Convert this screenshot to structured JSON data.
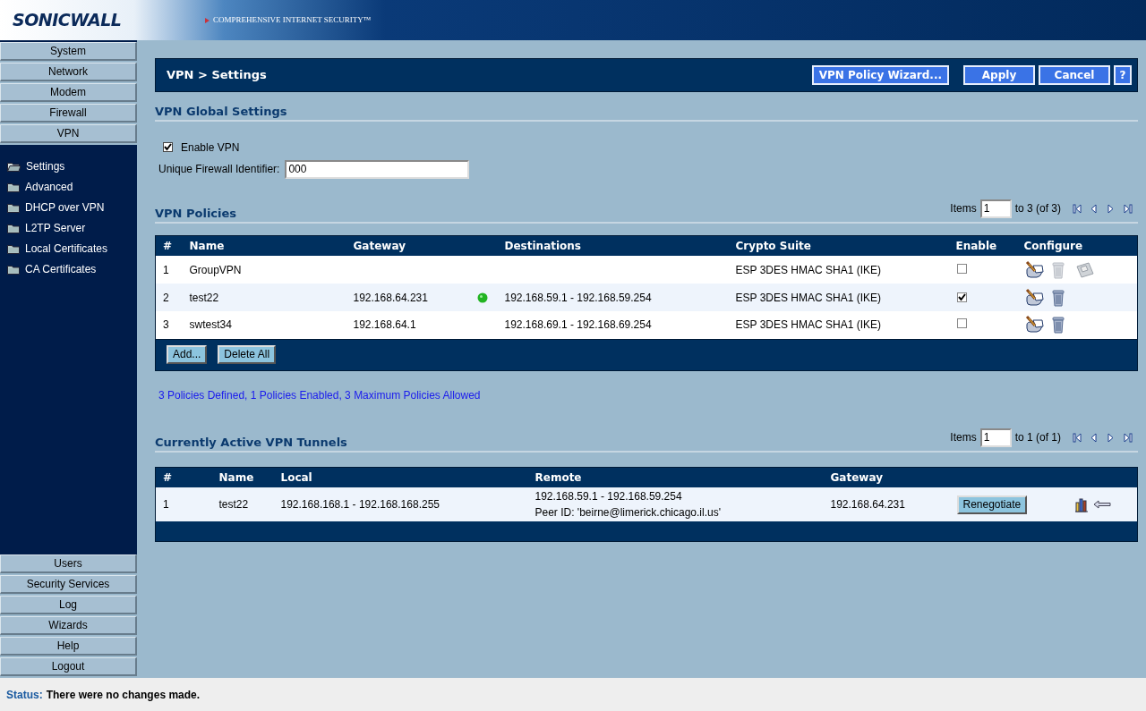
{
  "header": {
    "logo": "SONICWALL",
    "tagline": "COMPREHENSIVE INTERNET SECURITY™"
  },
  "nav_top": [
    {
      "label": "System"
    },
    {
      "label": "Network"
    },
    {
      "label": "Modem"
    },
    {
      "label": "Firewall"
    },
    {
      "label": "VPN"
    }
  ],
  "nav_items": [
    {
      "label": "Settings",
      "selected": true
    },
    {
      "label": "Advanced",
      "selected": false
    },
    {
      "label": "DHCP over VPN",
      "selected": false
    },
    {
      "label": "L2TP Server",
      "selected": false
    },
    {
      "label": "Local Certificates",
      "selected": false
    },
    {
      "label": "CA Certificates",
      "selected": false
    }
  ],
  "nav_bottom": [
    {
      "label": "Users"
    },
    {
      "label": "Security Services"
    },
    {
      "label": "Log"
    },
    {
      "label": "Wizards"
    },
    {
      "label": "Help"
    },
    {
      "label": "Logout"
    }
  ],
  "title_bar": {
    "title": "VPN > Settings",
    "buttons": [
      "VPN Policy Wizard...",
      "Apply",
      "Cancel",
      "?"
    ]
  },
  "global_settings": {
    "heading": "VPN Global Settings",
    "enable_label": "Enable VPN",
    "enable_checked": true,
    "identifier_label": "Unique Firewall Identifier:",
    "identifier_value": "000"
  },
  "policies": {
    "heading": "VPN Policies",
    "pager": {
      "label": "Items",
      "value": "1",
      "range": "to 3 (of 3)"
    },
    "columns": [
      "#",
      "Name",
      "Gateway",
      "Destinations",
      "Crypto Suite",
      "Enable",
      "Configure"
    ],
    "rows": [
      {
        "num": "1",
        "name": "GroupVPN",
        "gateway": "",
        "tunnel_up": false,
        "destinations": "",
        "crypto": "ESP 3DES HMAC SHA1 (IKE)",
        "enabled": false,
        "delete_disabled": true,
        "has_export": true
      },
      {
        "num": "2",
        "name": "test22",
        "gateway": "192.168.64.231",
        "tunnel_up": true,
        "destinations": "192.168.59.1 - 192.168.59.254",
        "crypto": "ESP 3DES HMAC SHA1 (IKE)",
        "enabled": true,
        "delete_disabled": false,
        "has_export": false
      },
      {
        "num": "3",
        "name": "swtest34",
        "gateway": "192.168.64.1",
        "tunnel_up": false,
        "destinations": "192.168.69.1 - 192.168.69.254",
        "crypto": "ESP 3DES HMAC SHA1 (IKE)",
        "enabled": false,
        "delete_disabled": false,
        "has_export": false
      }
    ],
    "buttons": [
      "Add...",
      "Delete All"
    ],
    "summary": "3 Policies Defined, 1 Policies Enabled, 3 Maximum Policies Allowed"
  },
  "tunnels": {
    "heading": "Currently Active VPN Tunnels",
    "pager": {
      "label": "Items",
      "value": "1",
      "range": "to 1 (of 1)"
    },
    "columns": [
      "#",
      "Name",
      "Local",
      "Remote",
      "Gateway"
    ],
    "rows": [
      {
        "num": "1",
        "name": "test22",
        "local": "192.168.168.1 - 192.168.168.255",
        "remote": [
          "192.168.59.1 - 192.168.59.254",
          "Peer ID: 'beirne@limerick.chicago.il.us'"
        ],
        "gateway": "192.168.64.231",
        "button": "Renegotiate"
      }
    ]
  },
  "status_bar": {
    "label": "Status:",
    "message": "There were no changes made."
  }
}
